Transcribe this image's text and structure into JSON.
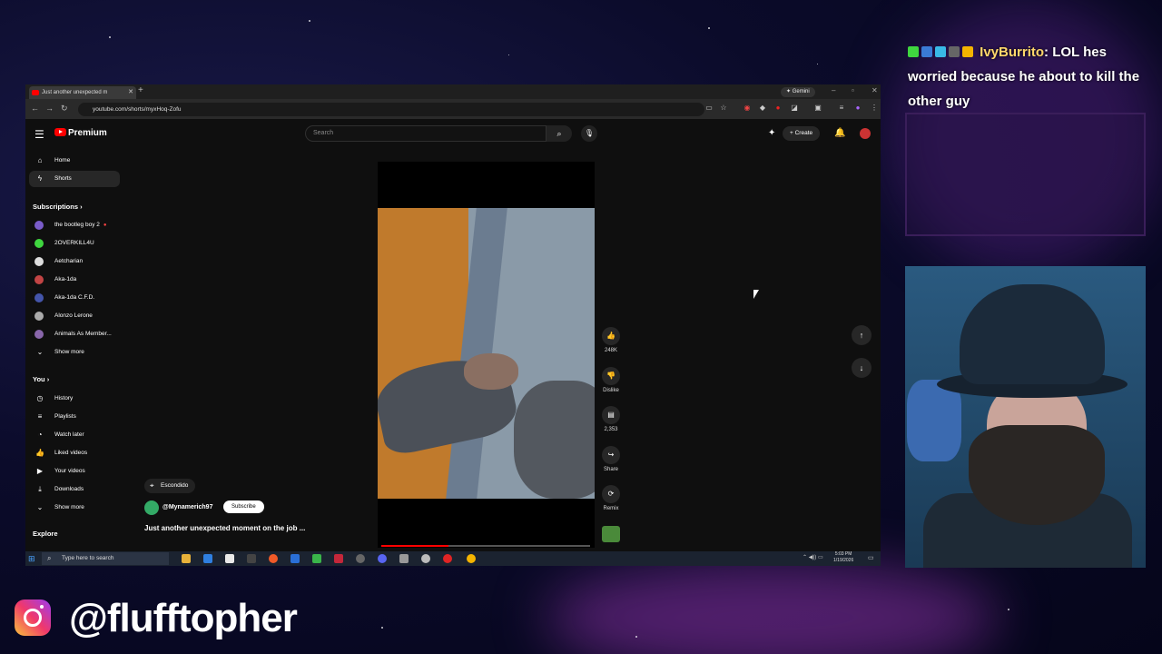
{
  "browser": {
    "tab_title": "Just another unexpected m",
    "gemini_label": "Gemini",
    "url": "youtube.com/shorts/myxHoq-Zofu"
  },
  "youtube": {
    "logo_label": "Premium",
    "search_placeholder": "Search",
    "create_label": "Create",
    "sidebar": {
      "main": [
        {
          "label": "Home",
          "icon": "home-icon"
        },
        {
          "label": "Shorts",
          "icon": "shorts-icon",
          "active": true
        }
      ],
      "subscriptions_heading": "Subscriptions",
      "subscriptions": [
        {
          "label": "the bootleg boy 2",
          "color": "#7a5cc9"
        },
        {
          "label": "2OVERKILL4U",
          "color": "#3fd63f"
        },
        {
          "label": "Aetcharian",
          "color": "#dddddd"
        },
        {
          "label": "Aka-1da",
          "color": "#c24444"
        },
        {
          "label": "Aka-1da C.F.D.",
          "color": "#4455aa"
        },
        {
          "label": "Alonzo Lerone",
          "color": "#aaaaaa"
        },
        {
          "label": "Animals As Member...",
          "color": "#8866aa"
        }
      ],
      "show_more": "Show more",
      "you_heading": "You",
      "you_items": [
        {
          "label": "History",
          "icon": "history-icon"
        },
        {
          "label": "Playlists",
          "icon": "playlists-icon"
        },
        {
          "label": "Watch later",
          "icon": "watch-later-icon"
        },
        {
          "label": "Liked videos",
          "icon": "like-icon"
        },
        {
          "label": "Your videos",
          "icon": "your-videos-icon"
        },
        {
          "label": "Downloads",
          "icon": "download-icon"
        }
      ],
      "show_more_2": "Show more",
      "explore_heading": "Explore"
    },
    "short": {
      "likes": "248K",
      "dislike_label": "Dislike",
      "comments": "2,353",
      "share_label": "Share",
      "remix_label": "Remix",
      "location": "Escondido",
      "channel": "@Mynamerich97",
      "subscribe_label": "Subscribe",
      "title": "Just another unexpected moment on the job ...",
      "progress": 0.32
    }
  },
  "taskbar": {
    "search_placeholder": "Type here to search",
    "time": "5:03 PM",
    "date": "1/19/2026"
  },
  "chat": {
    "username": "IvyBurrito",
    "message": ": LOL hes worried because he about to kill the other guy"
  },
  "social": {
    "handle": "@flufftopher",
    "icon": "instagram-icon"
  }
}
